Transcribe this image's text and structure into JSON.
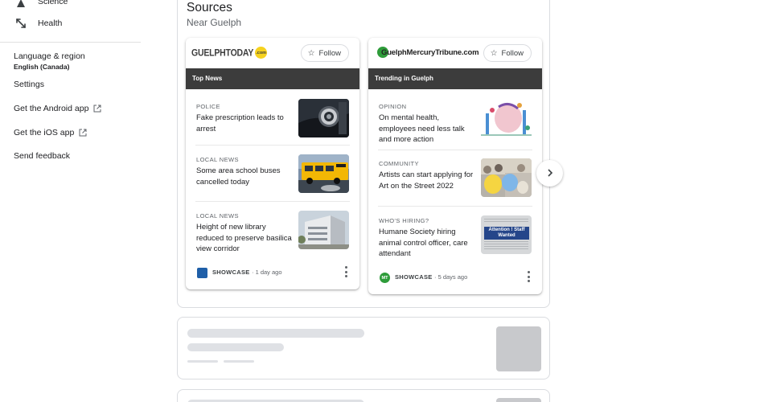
{
  "sidebar": {
    "items": [
      {
        "label": "Science",
        "icon": "science-icon"
      },
      {
        "label": "Health",
        "icon": "health-icon"
      }
    ],
    "language_label": "Language & region",
    "language_value": "English (Canada)",
    "settings_label": "Settings",
    "android_label": "Get the Android app",
    "ios_label": "Get the iOS app",
    "feedback_label": "Send feedback"
  },
  "sources": {
    "title": "Sources",
    "subtitle": "Near Guelph",
    "publishers": [
      {
        "name": "GuelphToday.com",
        "logo_text": "GUELPHTODAY",
        "logo_badge": ".com",
        "follow_label": "Follow",
        "section": "Top News",
        "articles": [
          {
            "category": "POLICE",
            "title": "Fake prescription leads to arrest",
            "thumb": "police-badge"
          },
          {
            "category": "LOCAL NEWS",
            "title": "Some area school buses cancelled today",
            "thumb": "school-bus"
          },
          {
            "category": "LOCAL NEWS",
            "title": "Height of new library reduced to preserve basilica view corridor",
            "thumb": "library"
          }
        ],
        "footer_source": "SHOWCASE",
        "footer_time": "1 day ago"
      },
      {
        "name": "GuelphMercuryTribune.com",
        "logo_text": "GuelphMercuryTribune.com",
        "follow_label": "Follow",
        "section": "Trending in Guelph",
        "articles": [
          {
            "category": "OPINION",
            "title": "On mental health, employees need less talk and more action",
            "thumb": "mental-health"
          },
          {
            "category": "COMMUNITY",
            "title": "Artists can start applying for Art on the Street 2022",
            "thumb": "balloons"
          },
          {
            "category": "WHO'S HIRING?",
            "title": "Humane Society hiring animal control officer, care attendant",
            "thumb": "staff-wanted"
          }
        ],
        "footer_source": "SHOWCASE",
        "footer_time": "5 days ago",
        "footer_badge": "MT"
      }
    ],
    "staff_wanted_text": "Attention ! Staff Wanted"
  },
  "colors": {
    "section_bar": "#3c3c3c",
    "guelph_today_badge": "#f6d21e",
    "mercury_green": "#2e9c3a"
  }
}
